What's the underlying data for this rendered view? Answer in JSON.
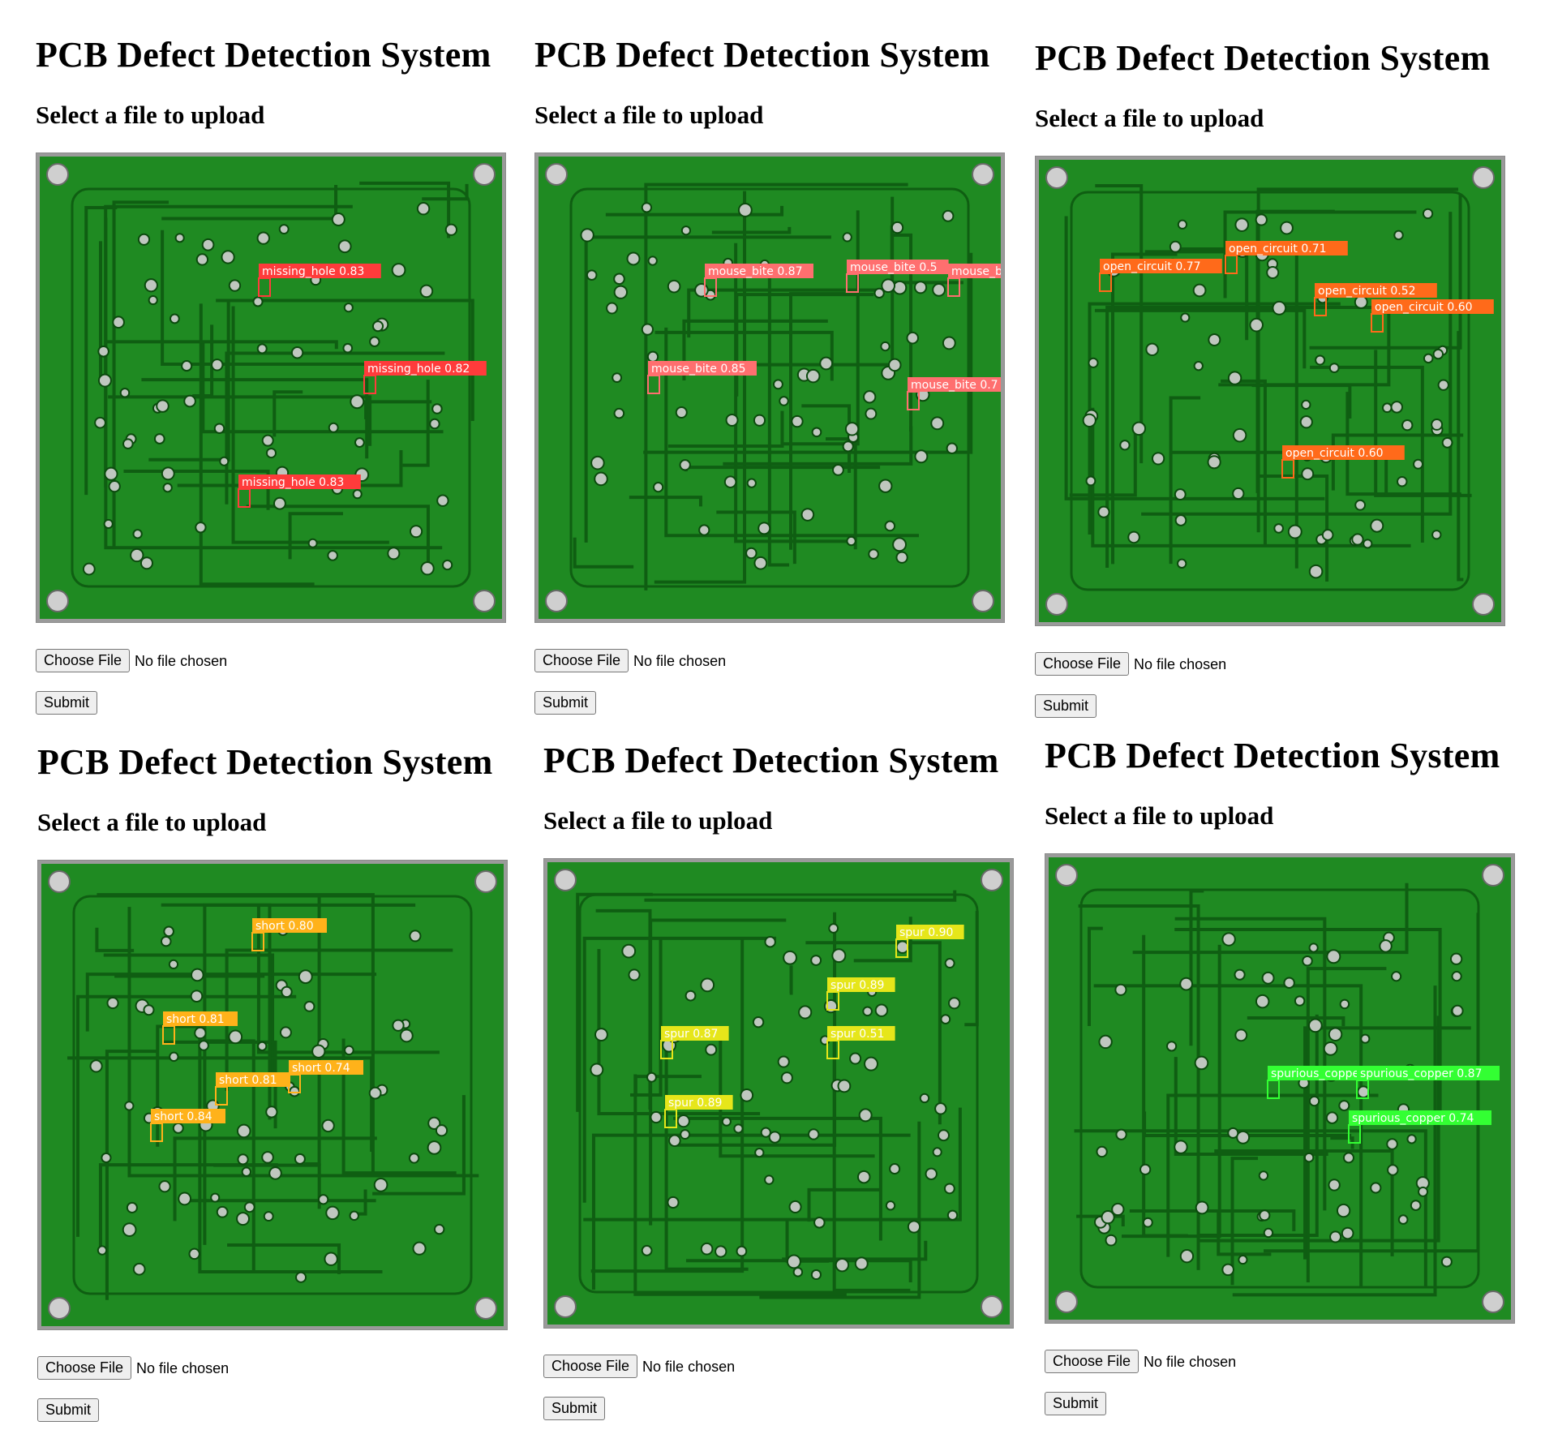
{
  "panels": [
    {
      "title": "PCB Defect Detection System",
      "subtitle": "Select a file to upload",
      "choose_label": "Choose File",
      "file_status": "No file chosen",
      "submit_label": "Submit",
      "defect_color": "#ff3b3b",
      "label_text_color": "#ffffff",
      "detections": [
        {
          "label": "missing_hole 0.83"
        },
        {
          "label": "missing_hole 0.82"
        },
        {
          "label": "missing_hole 0.83"
        }
      ]
    },
    {
      "title": "PCB Defect Detection System",
      "subtitle": "Select a file to upload",
      "choose_label": "Choose File",
      "file_status": "No file chosen",
      "submit_label": "Submit",
      "defect_color": "#ff6f6f",
      "label_text_color": "#ffffff",
      "detections": [
        {
          "label": "mouse_bite 0.87"
        },
        {
          "label": "mouse_bite 0.5"
        },
        {
          "label": "mouse_bi"
        },
        {
          "label": "mouse_bite 0.85"
        },
        {
          "label": "mouse_bite 0.7"
        }
      ]
    },
    {
      "title": "PCB Defect Detection System",
      "subtitle": "Select a file to upload",
      "choose_label": "Choose File",
      "file_status": "No file chosen",
      "submit_label": "Submit",
      "defect_color": "#ff6a1a",
      "label_text_color": "#ffffff",
      "detections": [
        {
          "label": "open_circuit 0.77"
        },
        {
          "label": "open_circuit 0.71"
        },
        {
          "label": "open_circuit 0.52"
        },
        {
          "label": "open_circuit 0.60"
        },
        {
          "label": "open_circuit 0.60"
        }
      ]
    },
    {
      "title": "PCB Defect Detection System",
      "subtitle": "Select a file to upload",
      "choose_label": "Choose File",
      "file_status": "No file chosen",
      "submit_label": "Submit",
      "defect_color": "#ffb21a",
      "label_text_color": "#ffffff",
      "detections": [
        {
          "label": "short 0.80"
        },
        {
          "label": "short 0.81"
        },
        {
          "label": "short 0.74"
        },
        {
          "label": "short 0.81"
        },
        {
          "label": "short 0.84"
        }
      ]
    },
    {
      "title": "PCB Defect Detection System",
      "subtitle": "Select a file to upload",
      "choose_label": "Choose File",
      "file_status": "No file chosen",
      "submit_label": "Submit",
      "defect_color": "#e6e61a",
      "label_text_color": "#ffffff",
      "detections": [
        {
          "label": "spur 0.90"
        },
        {
          "label": "spur 0.89"
        },
        {
          "label": "spur 0.87"
        },
        {
          "label": "spur 0.51"
        },
        {
          "label": "spur 0.89"
        }
      ]
    },
    {
      "title": "PCB Defect Detection System",
      "subtitle": "Select a file to upload",
      "choose_label": "Choose File",
      "file_status": "No file chosen",
      "submit_label": "Submit",
      "defect_color": "#33ff33",
      "label_text_color": "#ffffff",
      "detections": [
        {
          "label": "spurious_copper"
        },
        {
          "label": "spurious_copper 0.87"
        },
        {
          "label": "spurious_copper 0.74"
        }
      ]
    }
  ]
}
